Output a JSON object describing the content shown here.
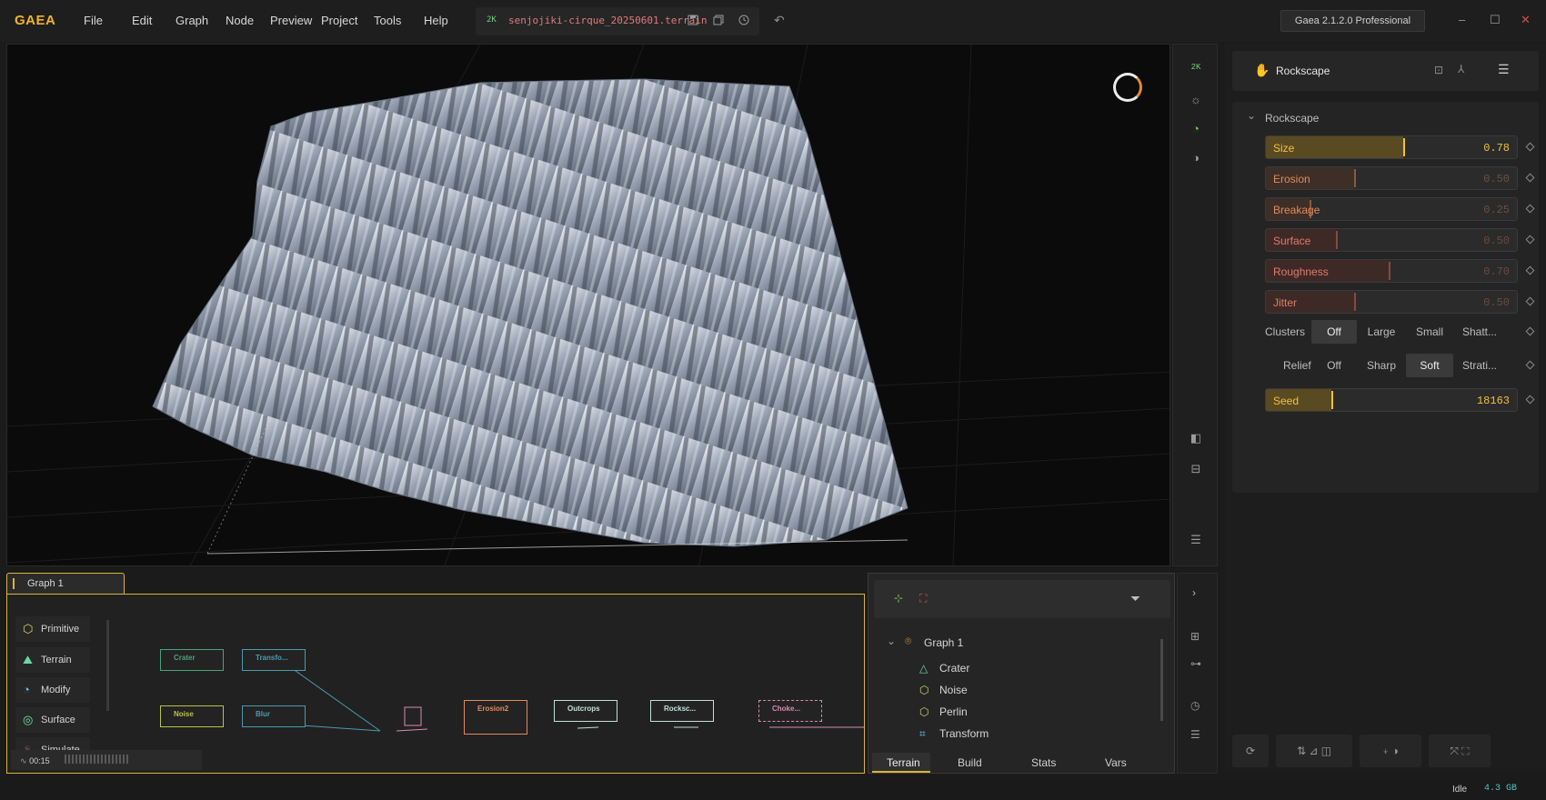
{
  "app": {
    "logo": "GAEA",
    "menu": [
      "File",
      "Edit",
      "Graph",
      "Node",
      "Preview",
      "Project",
      "Tools",
      "Help"
    ],
    "version": "Gaea 2.1.2.0 Professional"
  },
  "file": {
    "resolution": "2K",
    "name": "senjojiki-cirque_20250601.terrain"
  },
  "viewport": {
    "toolbar_resolution": "2K"
  },
  "properties": {
    "node_name": "Rockscape",
    "section_title": "Rockscape",
    "sliders": [
      {
        "label": "Size",
        "value": "0.78",
        "fraction": 0.78,
        "color": "#e8b84a"
      },
      {
        "label": "Erosion",
        "value": "0.50",
        "fraction": 0.5,
        "color": "#e08a5a"
      },
      {
        "label": "Breakage",
        "value": "0.25",
        "fraction": 0.25,
        "color": "#e08a5a"
      },
      {
        "label": "Surface",
        "value": "0.50",
        "fraction": 0.4,
        "color": "#e07a6a"
      },
      {
        "label": "Roughness",
        "value": "0.70",
        "fraction": 0.7,
        "color": "#e07a6a"
      },
      {
        "label": "Jitter",
        "value": "0.50",
        "fraction": 0.5,
        "color": "#e07a6a"
      }
    ],
    "clusters": {
      "label": "Clusters",
      "options": [
        "Off",
        "Large",
        "Small",
        "Shatt..."
      ],
      "selected": "Off"
    },
    "relief": {
      "label": "Relief",
      "options": [
        "Off",
        "Sharp",
        "Soft",
        "Strati..."
      ],
      "selected": "Soft"
    },
    "seed": {
      "label": "Seed",
      "value": "18163"
    }
  },
  "graph": {
    "tab": "Graph 1",
    "categories": [
      "Primitive",
      "Terrain",
      "Modify",
      "Surface",
      "Simulate"
    ],
    "nodes": [
      {
        "label": "Crater",
        "color": "#4aa37a"
      },
      {
        "label": "Transfo...",
        "color": "#4a9ab0"
      },
      {
        "label": "Noise",
        "color": "#b8c24a"
      },
      {
        "label": "Blur",
        "color": "#4a9ab0"
      },
      {
        "label": "Erosion2",
        "color": "#e08a5a"
      },
      {
        "label": "Outcrops",
        "color": "#bfe0d8"
      },
      {
        "label": "Rocksc...",
        "color": "#bfe0d8"
      },
      {
        "label": "Choke...",
        "color": "#d98ab0"
      }
    ],
    "timer": "00:15"
  },
  "nodelist": {
    "graph_name": "Graph 1",
    "items": [
      "Crater",
      "Noise",
      "Perlin",
      "Transform"
    ],
    "tabs": [
      "Terrain",
      "Build",
      "Stats",
      "Vars"
    ],
    "active_tab": "Terrain"
  },
  "status": {
    "state": "Idle",
    "memory": "4.3 GB"
  }
}
